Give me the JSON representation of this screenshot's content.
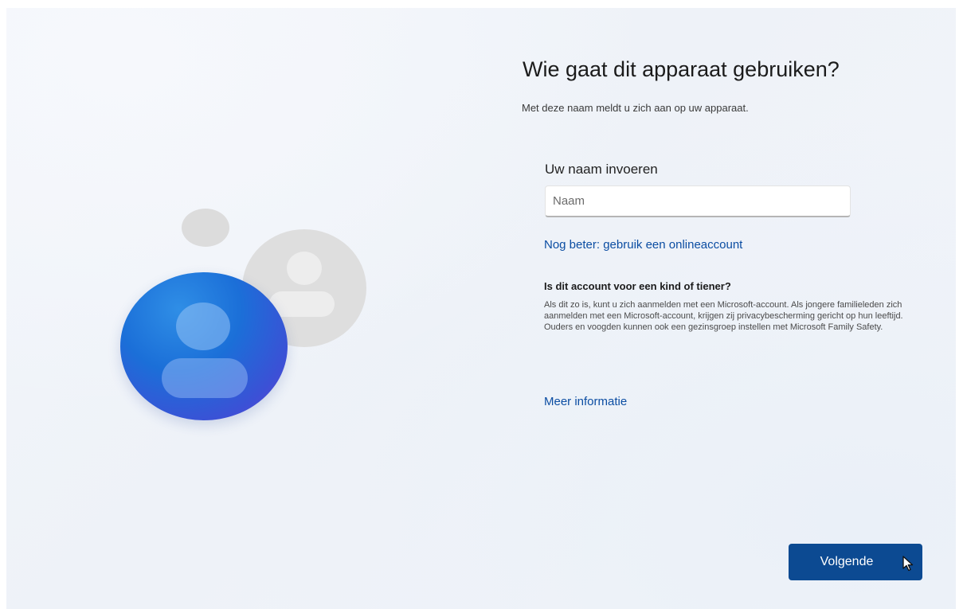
{
  "header": {
    "title": "Wie gaat dit apparaat gebruiken?",
    "subtitle": "Met deze naam meldt u zich aan op uw apparaat."
  },
  "form": {
    "name_label": "Uw naam invoeren",
    "name_placeholder": "Naam",
    "name_value": "",
    "online_account_link": "Nog beter: gebruik een onlineaccount"
  },
  "info": {
    "heading": "Is dit account voor een kind of tiener?",
    "body": "Als dit zo is, kunt u zich aanmelden met een Microsoft-account. Als jongere familieleden zich aanmelden met een Microsoft-account, krijgen zij privacybescherming gericht op hun leeftijd. Ouders en voogden kunnen ook een gezinsgroep instellen met Microsoft Family Safety.",
    "more_link": "Meer informatie"
  },
  "footer": {
    "next_label": "Volgende"
  },
  "icons": {
    "illustration": "users-icon",
    "cursor": "mouse-pointer-icon"
  },
  "colors": {
    "accent": "#0c4a92",
    "link": "#0b4da2",
    "avatar_blue": "#1b6fd8"
  }
}
